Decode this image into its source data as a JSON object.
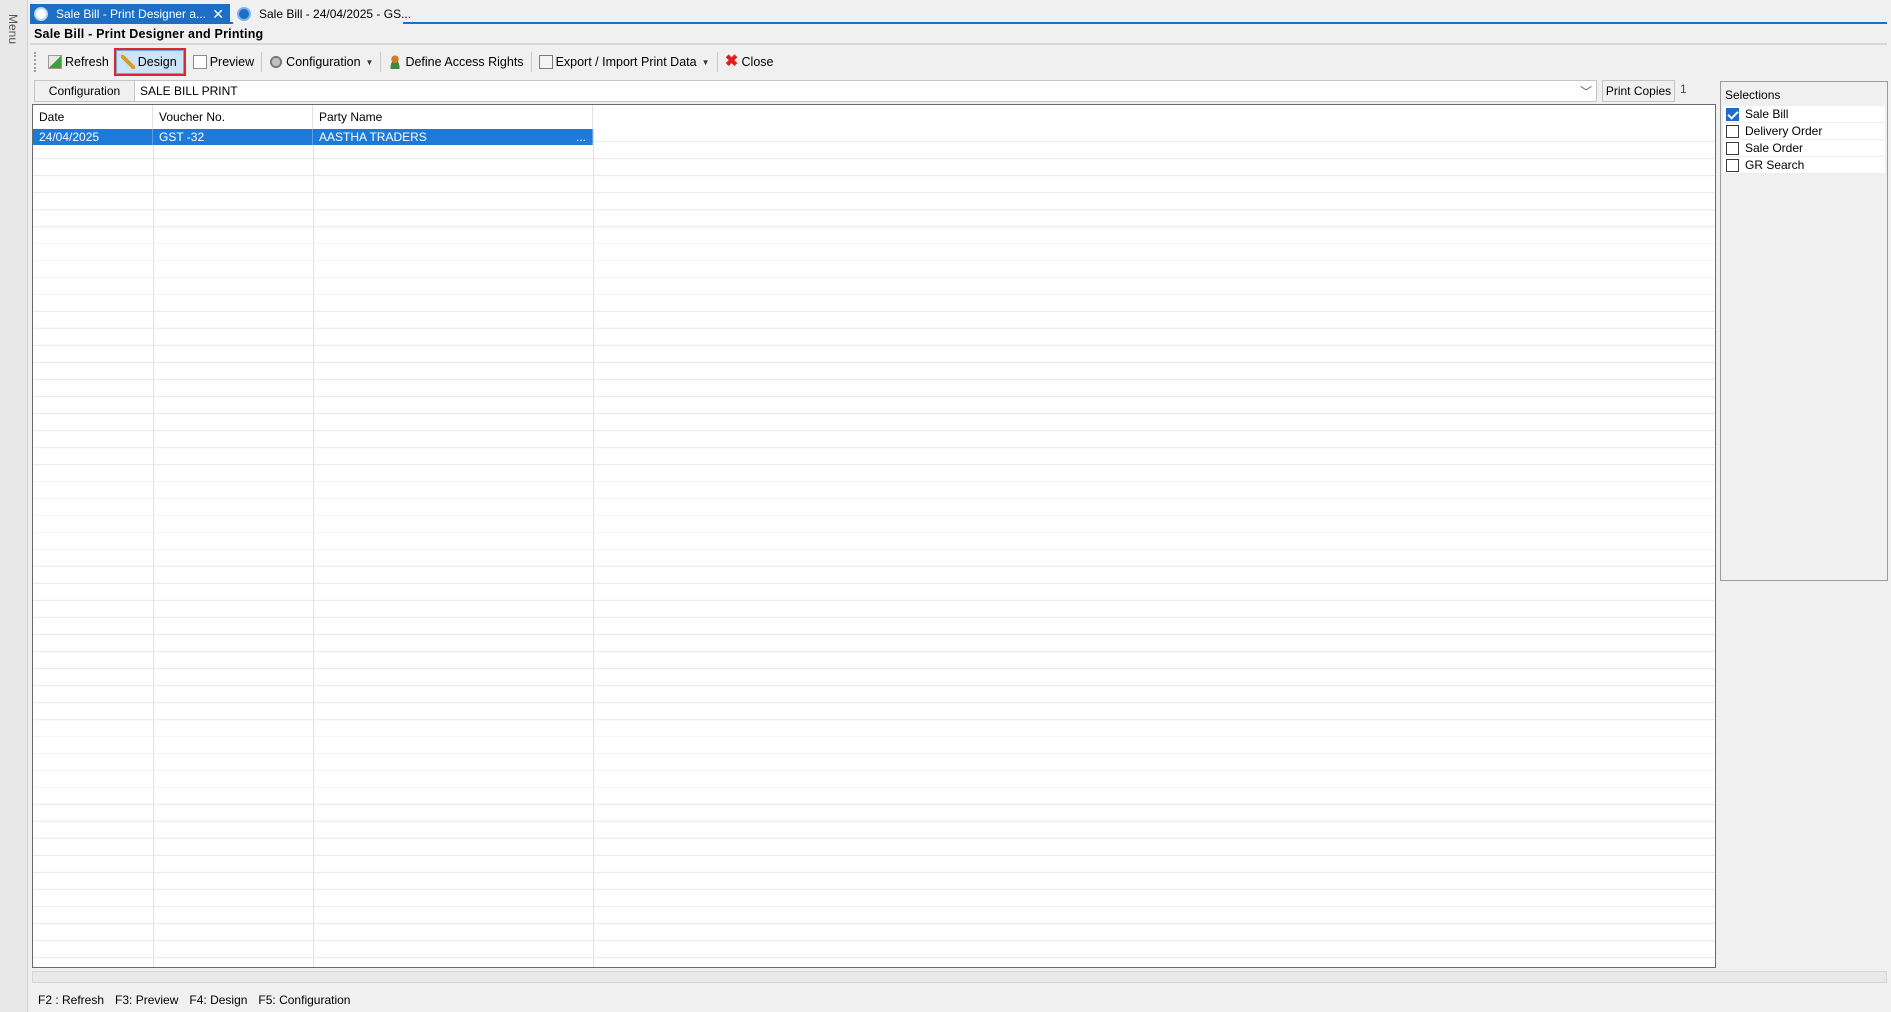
{
  "menu": {
    "label": "Menu"
  },
  "tabs": [
    {
      "label": "Sale Bill - Print Designer a..."
    },
    {
      "label": "Sale Bill - 24/04/2025 - GS..."
    }
  ],
  "window": {
    "title": "Sale Bill - Print Designer and Printing"
  },
  "toolbar": {
    "refresh": "Refresh",
    "design": "Design",
    "preview": "Preview",
    "configuration": "Configuration",
    "access_rights": "Define Access Rights",
    "export_import": "Export / Import Print Data",
    "close": "Close"
  },
  "config": {
    "label": "Configuration",
    "value": "SALE BILL PRINT",
    "print_copies_label": "Print Copies",
    "print_copies_value": "1"
  },
  "grid": {
    "columns": [
      "Date",
      "Voucher No.",
      "Party Name"
    ],
    "rows": [
      {
        "date": "24/04/2025",
        "voucher": "GST -32",
        "party": "AASTHA TRADERS",
        "more": "..."
      }
    ]
  },
  "selections": {
    "title": "Selections",
    "items": [
      {
        "label": "Sale Bill",
        "checked": true
      },
      {
        "label": "Delivery Order",
        "checked": false
      },
      {
        "label": "Sale Order",
        "checked": false
      },
      {
        "label": "GR Search",
        "checked": false
      }
    ]
  },
  "status": {
    "f2": "F2 : Refresh",
    "f3": "F3:  Preview",
    "f4": "F4: Design",
    "f5": "F5: Configuration"
  },
  "colors": {
    "accent": "#1c6fc4",
    "selection_row": "#1e7ad6",
    "highlight_border": "#e0252c"
  }
}
